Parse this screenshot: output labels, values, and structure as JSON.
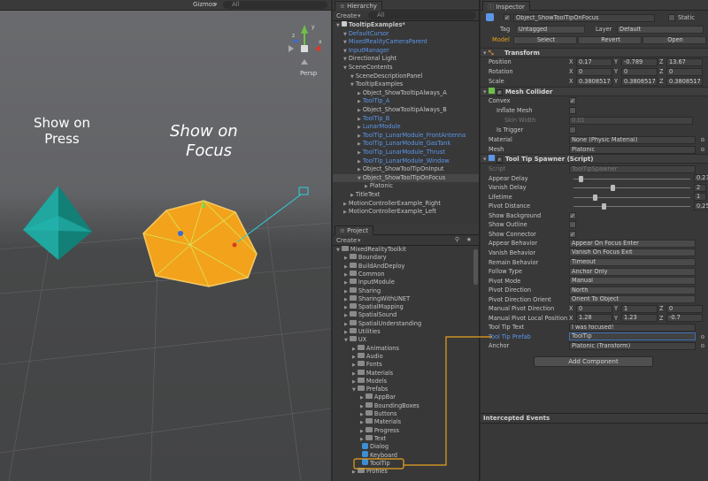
{
  "scene": {
    "tab": "Gizmos",
    "search": "All",
    "persp": "Persp",
    "label_press": [
      "Show on",
      "Press"
    ],
    "label_focus": [
      "Show on",
      "Focus"
    ],
    "gizmo_axes": {
      "x": "x",
      "y": "y",
      "z": "z"
    }
  },
  "hierarchy": {
    "tab": "Hierarchy",
    "create": "Create",
    "search": "All",
    "rows": [
      {
        "t": "TooltipExamples*",
        "d": 0,
        "blue": false,
        "bold": true
      },
      {
        "t": "DefaultCursor",
        "d": 1,
        "blue": true
      },
      {
        "t": "MixedRealityCameraParent",
        "d": 1,
        "blue": true
      },
      {
        "t": "InputManager",
        "d": 1,
        "blue": true
      },
      {
        "t": "Directional Light",
        "d": 1,
        "blue": false
      },
      {
        "t": "SceneContents",
        "d": 1,
        "blue": false
      },
      {
        "t": "SceneDescriptionPanel",
        "d": 2,
        "blue": false
      },
      {
        "t": "TooltipExamples",
        "d": 2,
        "blue": false
      },
      {
        "t": "Object_ShowTooltipAlways_A",
        "d": 3,
        "blue": false
      },
      {
        "t": "ToolTip_A",
        "d": 3,
        "blue": true
      },
      {
        "t": "Object_ShowTooltipAlways_B",
        "d": 3,
        "blue": false
      },
      {
        "t": "ToolTip_B",
        "d": 3,
        "blue": true
      },
      {
        "t": "LunarModule",
        "d": 3,
        "blue": true
      },
      {
        "t": "ToolTip_LunarModule_FrontAntenna",
        "d": 3,
        "blue": true
      },
      {
        "t": "ToolTip_LunarModule_GasTank",
        "d": 3,
        "blue": true
      },
      {
        "t": "ToolTip_LunarModule_Thrust",
        "d": 3,
        "blue": true
      },
      {
        "t": "ToolTip_LunarModule_Window",
        "d": 3,
        "blue": true
      },
      {
        "t": "Object_ShowToolTipOnInput",
        "d": 3,
        "blue": false
      },
      {
        "t": "Object_ShowToolTipOnFocus",
        "d": 3,
        "blue": false,
        "sel": true
      },
      {
        "t": "Platonic",
        "d": 4,
        "blue": false
      },
      {
        "t": "TitleText",
        "d": 2,
        "blue": false
      },
      {
        "t": "MotionControllerExample_Right",
        "d": 1,
        "blue": false
      },
      {
        "t": "MotionControllerExample_Left",
        "d": 1,
        "blue": false
      }
    ]
  },
  "project": {
    "tab": "Project",
    "create": "Create",
    "rows": [
      {
        "t": "MixedRealityToolkit",
        "d": 0,
        "open": true
      },
      {
        "t": "Boundary",
        "d": 1
      },
      {
        "t": "BuildAndDeploy",
        "d": 1
      },
      {
        "t": "Common",
        "d": 1
      },
      {
        "t": "InputModule",
        "d": 1
      },
      {
        "t": "Sharing",
        "d": 1
      },
      {
        "t": "SharingWithUNET",
        "d": 1
      },
      {
        "t": "SpatialMapping",
        "d": 1
      },
      {
        "t": "SpatialSound",
        "d": 1
      },
      {
        "t": "SpatialUnderstanding",
        "d": 1
      },
      {
        "t": "Utilities",
        "d": 1
      },
      {
        "t": "UX",
        "d": 1,
        "open": true
      },
      {
        "t": "Animations",
        "d": 2
      },
      {
        "t": "Audio",
        "d": 2
      },
      {
        "t": "Fonts",
        "d": 2
      },
      {
        "t": "Materials",
        "d": 2
      },
      {
        "t": "Models",
        "d": 2
      },
      {
        "t": "Prefabs",
        "d": 2,
        "open": true
      },
      {
        "t": "AppBar",
        "d": 3
      },
      {
        "t": "BoundingBoxes",
        "d": 3
      },
      {
        "t": "Buttons",
        "d": 3
      },
      {
        "t": "Materials",
        "d": 3
      },
      {
        "t": "Progress",
        "d": 3
      },
      {
        "t": "Text",
        "d": 3
      },
      {
        "t": "Dialog",
        "d": 3,
        "prefab": true
      },
      {
        "t": "Keyboard",
        "d": 3,
        "prefab": true
      },
      {
        "t": "ToolTip",
        "d": 3,
        "prefab": true,
        "hl": true
      },
      {
        "t": "Profiles",
        "d": 2
      }
    ]
  },
  "inspector": {
    "tab": "Inspector",
    "object_name": "Object_ShowToolTipOnFocus",
    "static": "Static",
    "tag_label": "Tag",
    "tag": "Untagged",
    "layer_label": "Layer",
    "layer": "Default",
    "model_label": "Model",
    "select": "Select",
    "revert": "Revert",
    "open": "Open",
    "transform": {
      "title": "Transform",
      "position": {
        "label": "Position",
        "x": "0.17",
        "y": "-0.789",
        "z": "13.67"
      },
      "rotation": {
        "label": "Rotation",
        "x": "0",
        "y": "0",
        "z": "0"
      },
      "scale": {
        "label": "Scale",
        "x": "0.3808517",
        "y": "0.3808517",
        "z": "0.3808517"
      }
    },
    "mesh_collider": {
      "title": "Mesh Collider",
      "convex": "Convex",
      "inflate": "Inflate Mesh",
      "skin": "Skin Width",
      "skin_val": "0.01",
      "trigger": "Is Trigger",
      "material": "Material",
      "material_val": "None (Physic Material)",
      "mesh": "Mesh",
      "mesh_val": "Platonic"
    },
    "spawner": {
      "title": "Tool Tip Spawner (Script)",
      "script": "Script",
      "script_val": "ToolTipSpawner",
      "appear_delay": "Appear Delay",
      "appear_delay_val": "0.23",
      "appear_delay_pct": 0.05,
      "vanish_delay": "Vanish Delay",
      "vanish_delay_val": "2",
      "vanish_delay_pct": 0.33,
      "lifetime": "Lifetime",
      "lifetime_val": "1",
      "lifetime_pct": 0.17,
      "pivot_distance": "Pivot Distance",
      "pivot_distance_val": "0.25",
      "pivot_distance_pct": 0.25,
      "show_bg": "Show Background",
      "show_outline": "Show Outline",
      "show_conn": "Show Connector",
      "appear_beh": "Appear Behavior",
      "appear_beh_val": "Appear On Focus Enter",
      "vanish_beh": "Vanish Behavior",
      "vanish_beh_val": "Vanish On Focus Exit",
      "remain_beh": "Remain Behavior",
      "remain_beh_val": "Timeout",
      "follow": "Follow Type",
      "follow_val": "Anchor Only",
      "pivot_mode": "Pivot Mode",
      "pivot_mode_val": "Manual",
      "pivot_dir": "Pivot Direction",
      "pivot_dir_val": "North",
      "pivot_orient": "Pivot Direction Orient",
      "pivot_orient_val": "Orient To Object",
      "man_dir": "Manual Pivot Direction",
      "man_dir_x": "0",
      "man_dir_y": "1",
      "man_dir_z": "0",
      "man_pos": "Manual Pivot Local Position",
      "man_pos_x": "1.28",
      "man_pos_y": "1.23",
      "man_pos_z": "-0.7",
      "tip_text": "Tool Tip Text",
      "tip_text_val": "I was focused!",
      "tip_prefab": "Tool Tip Prefab",
      "tip_prefab_val": "ToolTip",
      "anchor": "Anchor",
      "anchor_val": "Platonic (Transform)"
    },
    "add_component": "Add Component",
    "intercepted": "Intercepted Events"
  },
  "colors": {
    "accent": "#e8a21f",
    "blue": "#5d96e8",
    "cyan": "#20a8a8",
    "orange": "#f3a21a"
  }
}
